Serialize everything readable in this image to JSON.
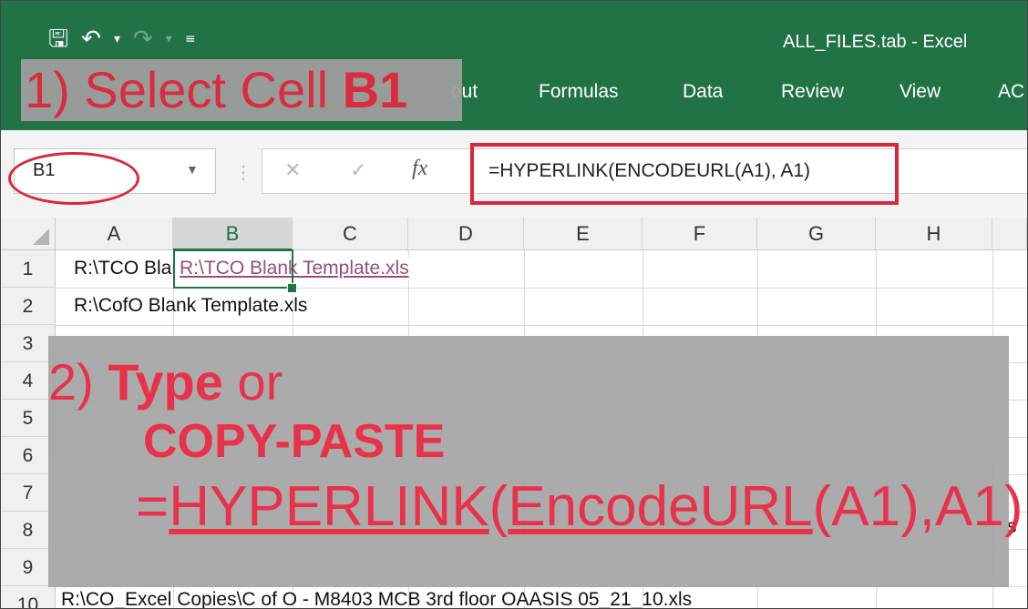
{
  "window": {
    "title": "ALL_FILES.tab - Excel"
  },
  "quick_access": {
    "save_icon": "save-icon",
    "undo_icon": "undo-icon",
    "redo_icon": "redo-icon",
    "customize_icon": "customize-qat-icon"
  },
  "ribbon": {
    "tabs": [
      {
        "label": "out"
      },
      {
        "label": "Formulas"
      },
      {
        "label": "Data"
      },
      {
        "label": "Review"
      },
      {
        "label": "View"
      },
      {
        "label": "AC"
      }
    ]
  },
  "formula_bar": {
    "name_box": "B1",
    "formula": "=HYPERLINK(ENCODEURL(A1), A1)",
    "fx_label": "fx"
  },
  "grid": {
    "columns": [
      "A",
      "B",
      "C",
      "D",
      "E",
      "F",
      "G",
      "H"
    ],
    "selected_column": "B",
    "rows": [
      "1",
      "2",
      "3",
      "4",
      "5",
      "6",
      "7",
      "8",
      "9",
      "10"
    ],
    "cells": {
      "A1": "R:\\TCO Blank Template.xls",
      "B1": "R:\\TCO Blank Template.xls",
      "A2": "R:\\CofO Blank Template.xls",
      "A10": "R:\\CO_Excel Copies\\C of O - M8403 MCB 3rd floor OAASIS 05_21_10.xls",
      "row8_tail": "s"
    }
  },
  "annotations": {
    "step1_prefix": "1) Select Cell ",
    "step1_cell": "B1",
    "step2_num": "2) ",
    "step2_bold": "Type",
    "step2_or": " or",
    "step2_copy": "COPY-PASTE",
    "step2_eq": "=",
    "step2_hyperlink": "HYPERLINK",
    "step2_paren": "(",
    "step2_encode": "EncodeURL",
    "step2_tail": "(A1),A1)"
  },
  "colors": {
    "ribbon_green": "#217346",
    "annotation_red": "#e8263f",
    "callout_gray": "#a6a6a6",
    "link_purple": "#954f72"
  }
}
